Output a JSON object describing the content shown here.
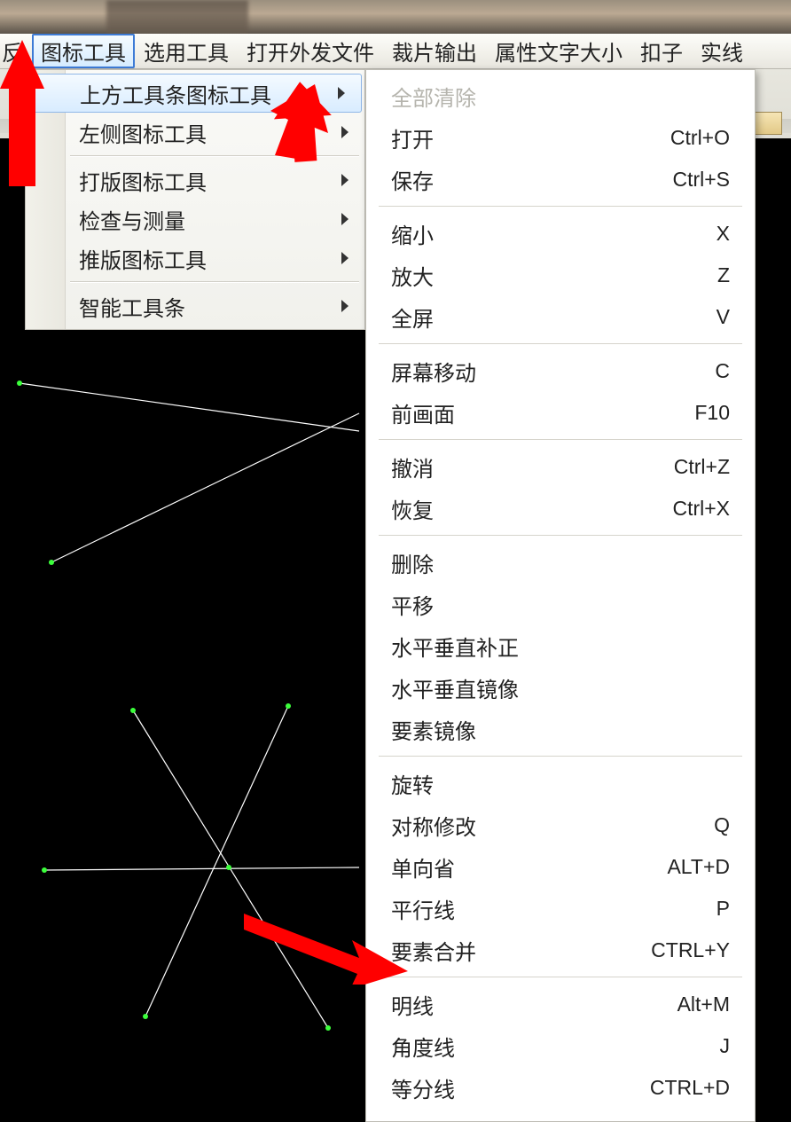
{
  "menubar": {
    "items": [
      {
        "label": "反"
      },
      {
        "label": "图标工具",
        "active": true
      },
      {
        "label": "选用工具"
      },
      {
        "label": "打开外发文件"
      },
      {
        "label": "裁片输出"
      },
      {
        "label": "属性文字大小"
      },
      {
        "label": "扣子"
      },
      {
        "label": "实线"
      }
    ]
  },
  "menu1": {
    "items": [
      {
        "label": "上方工具条图标工具",
        "submenu": true,
        "hover": true
      },
      {
        "label": "左侧图标工具",
        "submenu": true
      },
      "---",
      {
        "label": "打版图标工具",
        "submenu": true
      },
      {
        "label": "检查与测量",
        "submenu": true
      },
      {
        "label": "推版图标工具",
        "submenu": true
      },
      "---",
      {
        "label": "智能工具条",
        "submenu": true
      }
    ]
  },
  "menu2": {
    "items": [
      {
        "label": "全部清除",
        "disabled": true
      },
      {
        "label": "打开",
        "shortcut": "Ctrl+O"
      },
      {
        "label": "保存",
        "shortcut": "Ctrl+S"
      },
      "---",
      {
        "label": "缩小",
        "shortcut": "X"
      },
      {
        "label": "放大",
        "shortcut": "Z"
      },
      {
        "label": "全屏",
        "shortcut": "V"
      },
      "---",
      {
        "label": "屏幕移动",
        "shortcut": "C"
      },
      {
        "label": "前画面",
        "shortcut": "F10"
      },
      "---",
      {
        "label": "撤消",
        "shortcut": "Ctrl+Z"
      },
      {
        "label": "恢复",
        "shortcut": "Ctrl+X"
      },
      "---",
      {
        "label": "删除"
      },
      {
        "label": "平移"
      },
      {
        "label": "水平垂直补正"
      },
      {
        "label": "水平垂直镜像"
      },
      {
        "label": "要素镜像"
      },
      "---",
      {
        "label": "旋转"
      },
      {
        "label": "对称修改",
        "shortcut": "Q"
      },
      {
        "label": "单向省",
        "shortcut": "ALT+D"
      },
      {
        "label": "平行线",
        "shortcut": "P"
      },
      {
        "label": "要素合并",
        "shortcut": "CTRL+Y"
      },
      "---",
      {
        "label": "明线",
        "shortcut": "Alt+M"
      },
      {
        "label": "角度线",
        "shortcut": "J"
      },
      {
        "label": "等分线",
        "shortcut": "CTRL+D"
      }
    ]
  },
  "colors": {
    "endpoint": "#3bff3b",
    "line": "#ffffff",
    "arrow": "#ff0000"
  }
}
